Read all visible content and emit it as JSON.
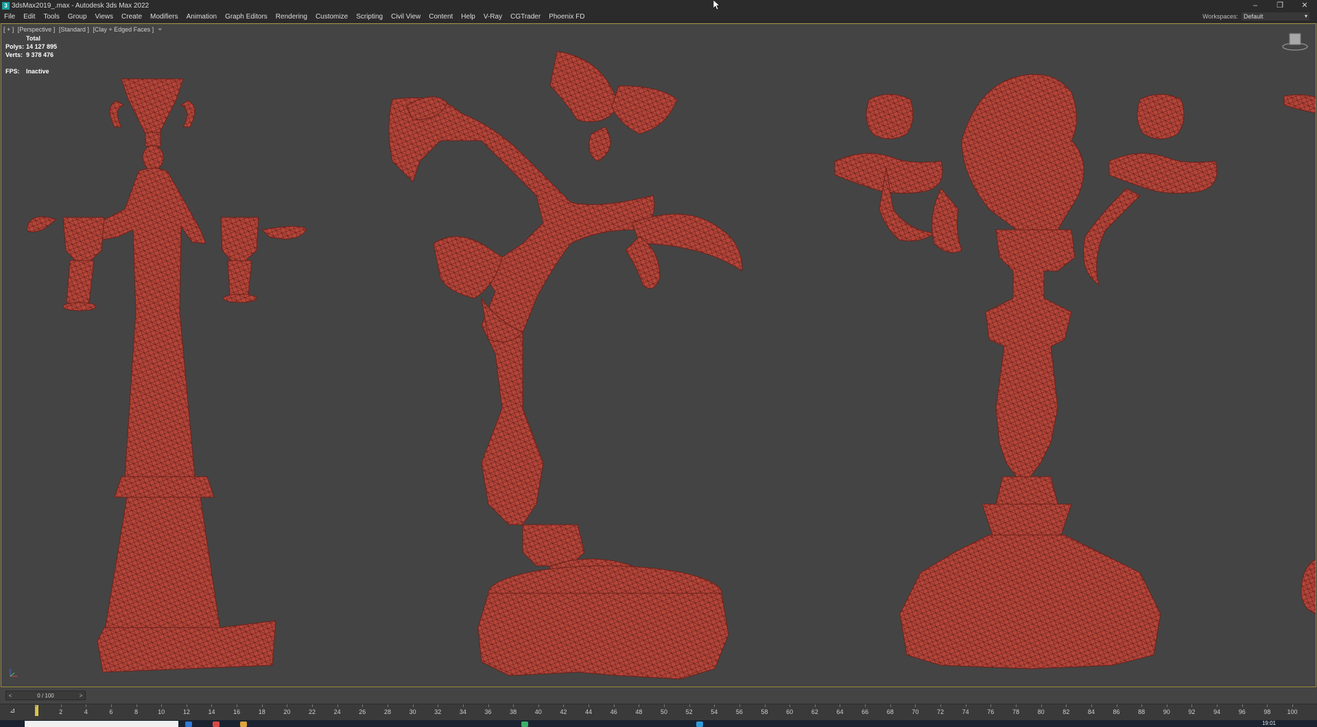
{
  "titlebar": {
    "app_icon": "3",
    "title": "3dsMax2019_.max - Autodesk 3ds Max 2022",
    "controls": {
      "minimize": "–",
      "restore": "❐",
      "close": "✕"
    }
  },
  "menubar": {
    "items": [
      "File",
      "Edit",
      "Tools",
      "Group",
      "Views",
      "Create",
      "Modifiers",
      "Animation",
      "Graph Editors",
      "Rendering",
      "Customize",
      "Scripting",
      "Civil View",
      "Content",
      "Help",
      "V-Ray",
      "CGTrader",
      "Phoenix FD"
    ],
    "workspaces_label": "Workspaces:",
    "workspaces_value": "Default"
  },
  "viewport": {
    "label_parts": [
      "[ + ]",
      "[Perspective ]",
      "[Standard ]",
      "[Clay + Edged Faces ]"
    ],
    "filter_icon": "filter-icon",
    "stats": {
      "total_label": "Total",
      "polys_label": "Polys:",
      "polys_value": "14 127 895",
      "verts_label": "Verts:",
      "verts_value": "9 378 476"
    },
    "fps_label": "FPS:",
    "fps_value": "Inactive",
    "model_color": "#b5453a",
    "background_color": "#444444"
  },
  "timeline": {
    "slider_prev": "<",
    "slider_value": "0 / 100",
    "slider_next": ">",
    "ticks": [
      "0",
      "2",
      "4",
      "6",
      "8",
      "10",
      "12",
      "14",
      "16",
      "18",
      "20",
      "22",
      "24",
      "26",
      "28",
      "30",
      "32",
      "34",
      "36",
      "38",
      "40",
      "42",
      "44",
      "46",
      "48",
      "50",
      "52",
      "54",
      "56",
      "58",
      "60",
      "62",
      "64",
      "66",
      "68",
      "70",
      "72",
      "74",
      "76",
      "78",
      "80",
      "82",
      "84",
      "86",
      "88",
      "90",
      "92",
      "94",
      "96",
      "98",
      "100"
    ]
  },
  "taskbar": {
    "clock": "19:01"
  }
}
